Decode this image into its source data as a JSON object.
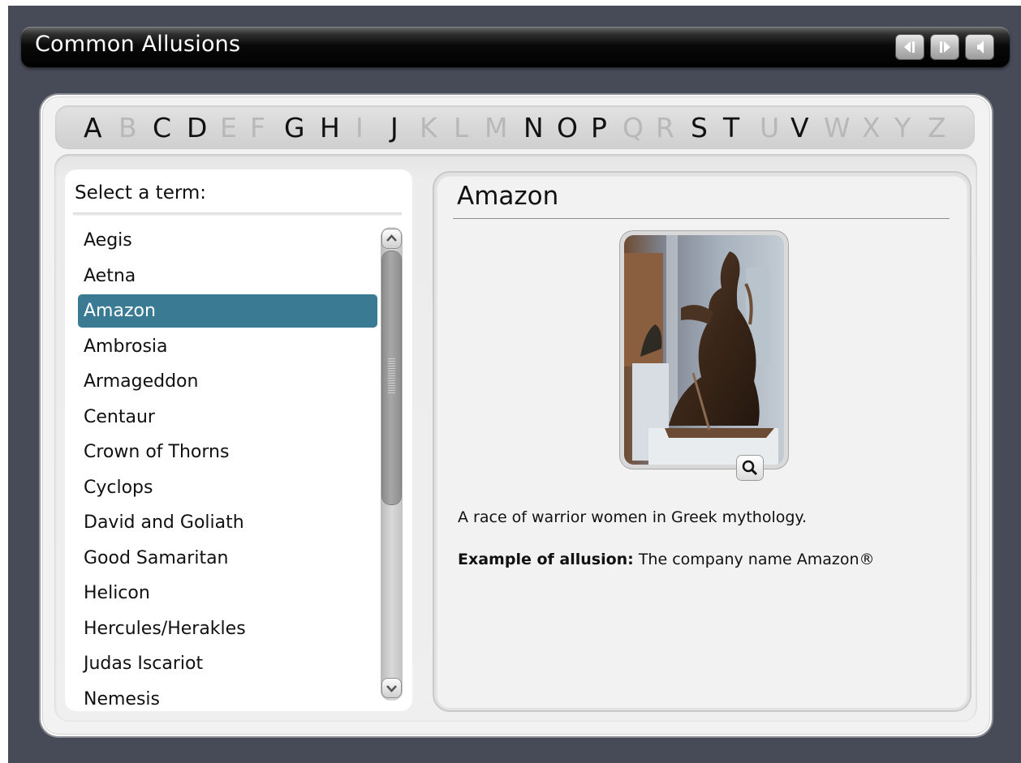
{
  "app": {
    "title": "Common Allusions"
  },
  "controls": [
    {
      "name": "previous-button",
      "icon": "back-icon"
    },
    {
      "name": "next-button",
      "icon": "forward-icon"
    },
    {
      "name": "audio-button",
      "icon": "speaker-icon"
    }
  ],
  "alphabet": [
    {
      "l": "A",
      "on": true
    },
    {
      "l": "B",
      "on": false
    },
    {
      "l": "C",
      "on": true
    },
    {
      "l": "D",
      "on": true
    },
    {
      "l": "E",
      "on": false
    },
    {
      "l": "F",
      "on": false
    },
    {
      "l": "G",
      "on": true
    },
    {
      "l": "H",
      "on": true
    },
    {
      "l": "I",
      "on": false
    },
    {
      "l": "J",
      "on": true
    },
    {
      "l": "K",
      "on": false
    },
    {
      "l": "L",
      "on": false
    },
    {
      "l": "M",
      "on": false
    },
    {
      "l": "N",
      "on": true
    },
    {
      "l": "O",
      "on": true
    },
    {
      "l": "P",
      "on": true
    },
    {
      "l": "Q",
      "on": false
    },
    {
      "l": "R",
      "on": false
    },
    {
      "l": "S",
      "on": true
    },
    {
      "l": "T",
      "on": true
    },
    {
      "l": "U",
      "on": false
    },
    {
      "l": "V",
      "on": true
    },
    {
      "l": "W",
      "on": false
    },
    {
      "l": "X",
      "on": false
    },
    {
      "l": "Y",
      "on": false
    },
    {
      "l": "Z",
      "on": false
    }
  ],
  "list": {
    "heading": "Select a term:",
    "selected": "Amazon",
    "terms": [
      "Aegis",
      "Aetna",
      "Amazon",
      "Ambrosia",
      "Armageddon",
      "Centaur",
      "Crown of Thorns",
      "Cyclops",
      "David and Goliath",
      "Good Samaritan",
      "Helicon",
      "Hercules/Herakles",
      "Judas Iscariot",
      "Nemesis"
    ]
  },
  "detail": {
    "title": "Amazon",
    "definition": "A race of warrior women in Greek mythology.",
    "example_label": "Example of allusion:",
    "example_text": " The company name Amazon®"
  },
  "colors": {
    "selection": "#3a7b93",
    "background": "#474a57"
  }
}
